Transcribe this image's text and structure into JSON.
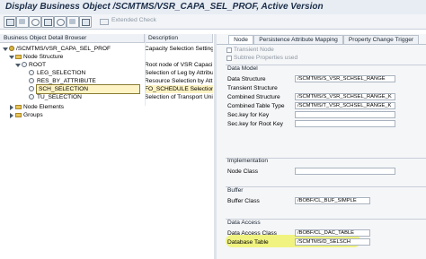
{
  "window": {
    "title": "Display Business Object /SCMTMS/VSR_CAPA_SEL_PROF, Active Version"
  },
  "toolbar": {
    "extended_check_label": "Extended Check"
  },
  "tree": {
    "header_col1": "Business Object Detail Browser",
    "header_col2": "Description",
    "rows": [
      {
        "label": "/SCMTMS/VSR_CAPA_SEL_PROF",
        "desc": "Capacity Selection Setting"
      },
      {
        "label": "Node Structure",
        "desc": ""
      },
      {
        "label": "ROOT",
        "desc": "Root node of VSR Capaci"
      },
      {
        "label": "LEG_SELECTION",
        "desc": "Selection of Leg by Attribu"
      },
      {
        "label": "RES_BY_ATTRIBUTE",
        "desc": "Resource Selection by Att"
      },
      {
        "label": "SCH_SELECTION",
        "desc": "FO_SCHEDULE Selection"
      },
      {
        "label": "TU_SELECTION",
        "desc": "Selection of Transport Uni"
      },
      {
        "label": "Node Elements",
        "desc": ""
      },
      {
        "label": "Groups",
        "desc": ""
      }
    ]
  },
  "tabs": [
    {
      "label": "Node"
    },
    {
      "label": "Persistence Attribute Mapping"
    },
    {
      "label": "Property Change Trigger"
    }
  ],
  "node_panel": {
    "transient_node": "Transient Node",
    "subtree_props": "Subtree Properties used",
    "data_model": {
      "title": "Data Model",
      "fields": [
        {
          "label": "Data Structure",
          "value": "/SCMTMS/S_VSR_SCHSEL_RANGE"
        },
        {
          "label": "Transient Structure",
          "value": ""
        },
        {
          "label": "Combined Structure",
          "value": "/SCMTMS/S_VSR_SCHSEL_RANGE_K"
        },
        {
          "label": "Combined Table Type",
          "value": "/SCMTMS/T_VSR_SCHSEL_RANGE_K"
        },
        {
          "label": "Sec.key for Key",
          "value": ""
        },
        {
          "label": "Sec.key for Root Key",
          "value": ""
        }
      ]
    },
    "implementation": {
      "title": "Implementation",
      "node_class_label": "Node Class",
      "node_class_value": ""
    },
    "buffer": {
      "title": "Buffer",
      "buffer_class_label": "Buffer Class",
      "buffer_class_value": "/BOBF/CL_BUF_SIMPLE"
    },
    "data_access": {
      "title": "Data Access",
      "class_label": "Data Access Class",
      "class_value": "/BOBF/CL_DAC_TABLE",
      "table_label": "Database Table",
      "table_value": "/SCMTMS/D_SELSCH"
    }
  },
  "colors": {
    "selection": "#fdf3c4",
    "highlight": "#eef26a",
    "folder": "#e8c65a"
  }
}
